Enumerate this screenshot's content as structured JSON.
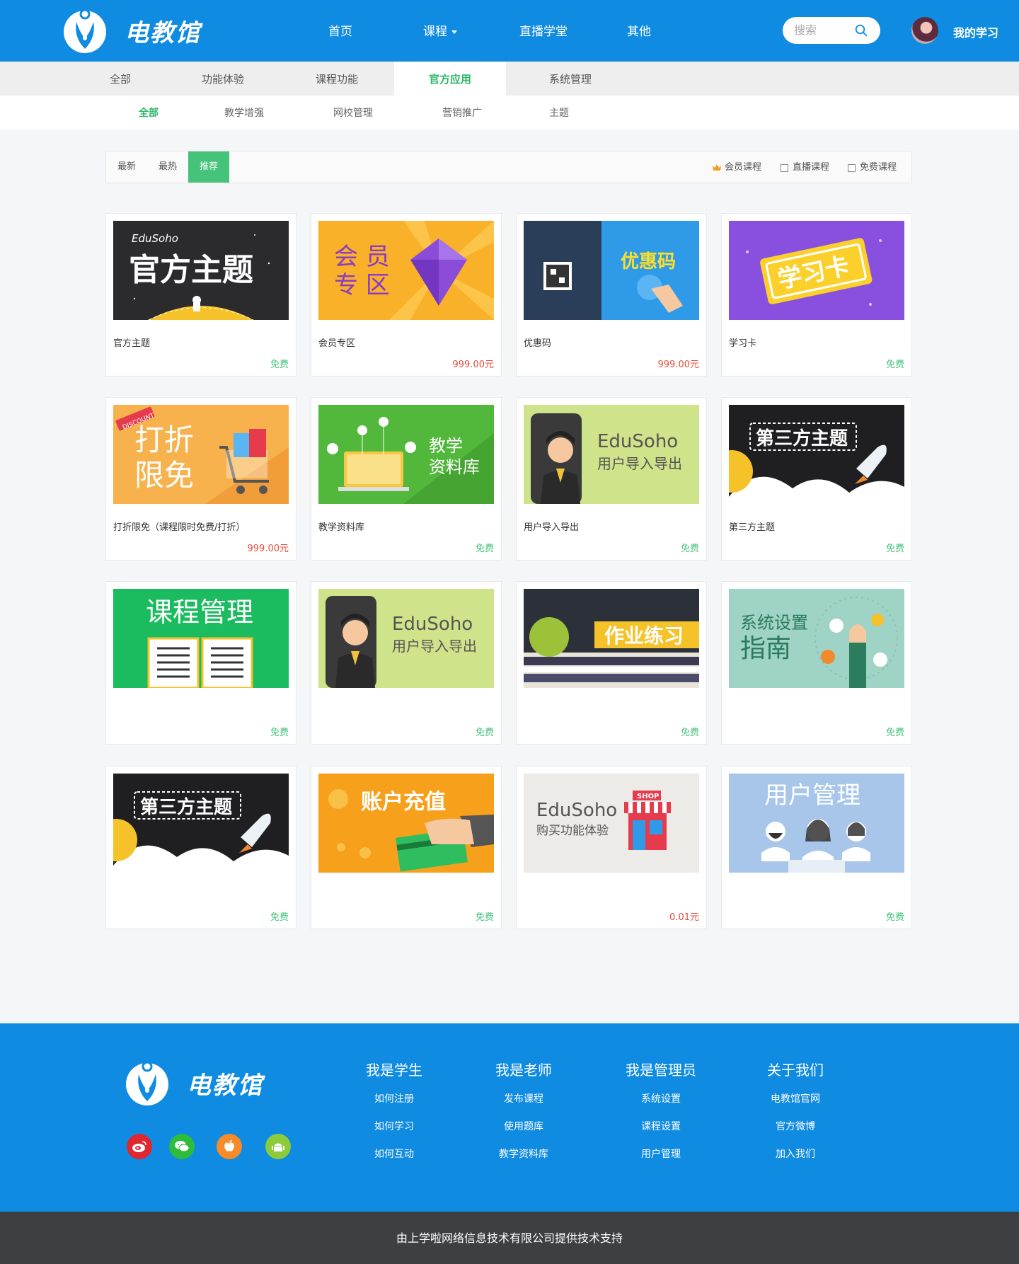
{
  "header": {
    "brand": "电教馆",
    "nav": [
      "首页",
      "课程",
      "直播学堂",
      "其他"
    ],
    "search_placeholder": "搜索",
    "my_study": "我的学习"
  },
  "categories": [
    "全部",
    "功能体验",
    "课程功能",
    "官方应用",
    "系统管理"
  ],
  "active_category": "官方应用",
  "subcategories": [
    "全部",
    "教学增强",
    "网校管理",
    "营销推广",
    "主题"
  ],
  "active_subcategory": "全部",
  "sort_tabs": [
    "最新",
    "最热",
    "推荐"
  ],
  "active_sort": "推荐",
  "filters": [
    "会员课程",
    "直播课程",
    "免费课程"
  ],
  "cards": [
    {
      "title": "官方主题",
      "price": "免费",
      "free": true,
      "thumb_text": "官方主题",
      "thumb_sub": "EduSoho"
    },
    {
      "title": "会员专区",
      "price": "999.00元",
      "free": false,
      "thumb_text": "会员专区"
    },
    {
      "title": "优惠码",
      "price": "999.00元",
      "free": false,
      "thumb_text": "优惠码"
    },
    {
      "title": "学习卡",
      "price": "免费",
      "free": true,
      "thumb_text": "学习卡"
    },
    {
      "title": "打折限免（课程限时免费/打折）",
      "price": "999.00元",
      "free": false,
      "thumb_text": "打折限免",
      "thumb_sub": "DISCOUNT"
    },
    {
      "title": "教学资料库",
      "price": "免费",
      "free": true,
      "thumb_text": "教学资料库"
    },
    {
      "title": "用户导入导出",
      "price": "免费",
      "free": true,
      "thumb_text": "用户导入导出",
      "thumb_sub": "EduSoho"
    },
    {
      "title": "第三方主题",
      "price": "免费",
      "free": true,
      "thumb_text": "第三方主题"
    },
    {
      "title": "",
      "price": "免费",
      "free": true,
      "thumb_text": "课程管理"
    },
    {
      "title": "",
      "price": "免费",
      "free": true,
      "thumb_text": "用户导入导出",
      "thumb_sub": "EduSoho"
    },
    {
      "title": "",
      "price": "免费",
      "free": true,
      "thumb_text": "作业练习"
    },
    {
      "title": "",
      "price": "免费",
      "free": true,
      "thumb_text": "系统设置指南"
    },
    {
      "title": "",
      "price": "免费",
      "free": true,
      "thumb_text": "第三方主题"
    },
    {
      "title": "",
      "price": "免费",
      "free": true,
      "thumb_text": "账户充值"
    },
    {
      "title": "",
      "price": "0.01元",
      "free": false,
      "thumb_text": "购买功能体验",
      "thumb_sub": "EduSoho"
    },
    {
      "title": "",
      "price": "免费",
      "free": true,
      "thumb_text": "用户管理"
    }
  ],
  "footer": {
    "brand": "电教馆",
    "columns": [
      {
        "title": "我是学生",
        "links": [
          "如何注册",
          "如何学习",
          "如何互动"
        ]
      },
      {
        "title": "我是老师",
        "links": [
          "发布课程",
          "使用题库",
          "教学资料库"
        ]
      },
      {
        "title": "我是管理员",
        "links": [
          "系统设置",
          "课程设置",
          "用户管理"
        ]
      },
      {
        "title": "关于我们",
        "links": [
          "电教馆官网",
          "官方微博",
          "加入我们"
        ]
      }
    ],
    "copyright": "由上学啦网络信息技术有限公司提供技术支持"
  },
  "colors": {
    "primary": "#0f8be1",
    "accent_green": "#46c37b",
    "price_red": "#e74c3c",
    "footer_dark": "#3d3f43"
  }
}
